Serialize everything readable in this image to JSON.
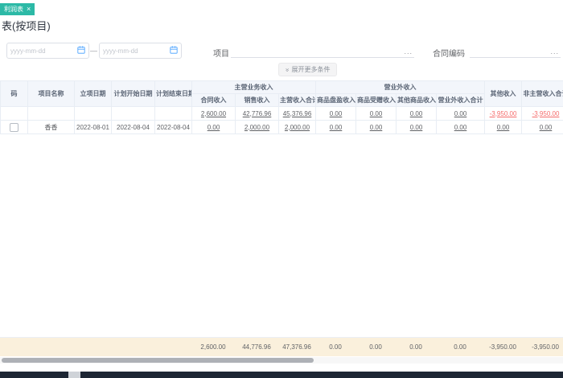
{
  "tab": {
    "label": "利润表",
    "close_icon": "×"
  },
  "page": {
    "title": "表(按项目)"
  },
  "filters": {
    "date_start": {
      "placeholder": "yyyy-mm-dd"
    },
    "date_end": {
      "placeholder": "yyyy-mm-dd"
    },
    "range_separator": "—",
    "project": {
      "label": "项目",
      "more": "..."
    },
    "contract": {
      "label": "合同编码",
      "more": "..."
    },
    "expand": {
      "icon": "»",
      "label": "展开更多条件"
    }
  },
  "table": {
    "headers": {
      "code": "码",
      "name": "项目名称",
      "setup_date": "立项日期",
      "plan_start": "计划开始日期",
      "plan_end": "计划结束日期",
      "group_main_income": "主营业务收入",
      "group_non_operating": "营业外收入",
      "sub": [
        "合同收入",
        "销售收入",
        "主营收入合计",
        "商品盘盈收入",
        "商品受赠收入",
        "其他商品收入",
        "营业外收入合计"
      ],
      "other_income": "其他收入",
      "non_main_total": "非主营收入合计"
    },
    "total_row": {
      "values": [
        "2,600.00",
        "42,776.96",
        "45,376.96",
        "0.00",
        "0.00",
        "0.00",
        "0.00",
        "-3,950.00",
        "-3,950.00"
      ]
    },
    "rows": [
      {
        "name": "香香",
        "setup_date": "2022-08-01",
        "plan_start": "2022-08-04",
        "plan_end": "2022-08-04",
        "values": [
          "0.00",
          "2,000.00",
          "2,000.00",
          "0.00",
          "0.00",
          "0.00",
          "0.00",
          "0.00",
          "0.00"
        ]
      }
    ],
    "summary": {
      "values": [
        "2,600.00",
        "44,776.96",
        "47,376.96",
        "0.00",
        "0.00",
        "0.00",
        "0.00",
        "-3,950.00",
        "-3,950.00"
      ]
    }
  },
  "colors": {
    "accent_teal": "#2cb9a6",
    "negative_red": "#f56c6c",
    "summary_bg": "#faf0dc",
    "header_bg": "#f3f6fb"
  }
}
